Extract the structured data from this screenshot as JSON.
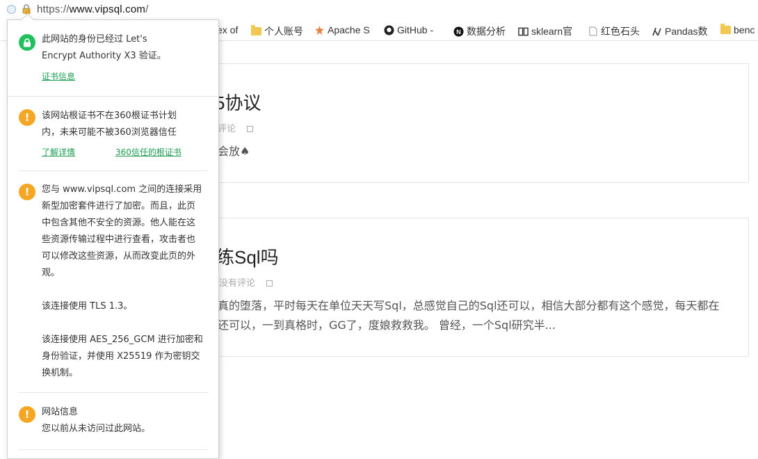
{
  "address_bar": {
    "url_prefix": "https://",
    "url_host": "www.vipsql.com",
    "url_suffix": "/"
  },
  "bookmarks": [
    {
      "label": "ex of",
      "icon": "page-icon"
    },
    {
      "label": "个人账号",
      "icon": "folder-icon"
    },
    {
      "label": "Apache S",
      "icon": "apache-feather-icon"
    },
    {
      "label": "GitHub -",
      "icon": "github-icon"
    },
    {
      "label": "数据分析",
      "icon": "n-logo-icon"
    },
    {
      "label": "sklearn官",
      "icon": "book-icon"
    },
    {
      "label": "红色石头",
      "icon": "page-icon"
    },
    {
      "label": "Pandas数",
      "icon": "pandas-icon"
    },
    {
      "label": "benc",
      "icon": "folder-icon"
    }
  ],
  "posts": [
    {
      "title": "5协议",
      "meta": "评论",
      "excerpt": "会放♠"
    },
    {
      "title": "练Sql吗",
      "meta": "没有评论",
      "excerpt_line1": "真的堕落，平时每天在单位天天写Sql，总感觉自己的Sql还可以，相信大部分都有这个感觉，每天都在",
      "excerpt_line2": "还可以，一到真格时，GG了，度娘救救我。 曾经，一个Sql研究半..."
    }
  ],
  "popup": {
    "identity": {
      "line1": "此网站的身份已经过 Let's",
      "line2": "Encrypt Authority X3 验证。",
      "link": "证书信息"
    },
    "root_cert": {
      "line1": "该网站根证书不在360根证书计划",
      "line2": "内，未来可能不被360浏览器信任",
      "link_details": "了解详情",
      "link_trusted": "360信任的根证书"
    },
    "connection": {
      "lines": [
        "您与 www.vipsql.com 之间的连接采用",
        "新型加密套件进行了加密。而且，此页",
        "中包含其他不安全的资源。他人能在这",
        "些资源传输过程中进行查看，攻击者也",
        "可以修改这些资源，从而改变此页的外",
        "观。"
      ],
      "tls": "该连接使用 TLS 1.3。",
      "cipher_lines": [
        "该连接使用 AES_256_GCM 进行加密和",
        "身份验证，并使用 X25519 作为密钥交",
        "换机制。"
      ]
    },
    "site_info": {
      "title": "网站信息",
      "text": "您以前从未访问过此网站。"
    }
  },
  "colors": {
    "green": "#21c05e",
    "orange": "#f5a623",
    "link_green": "#1d9e53"
  }
}
